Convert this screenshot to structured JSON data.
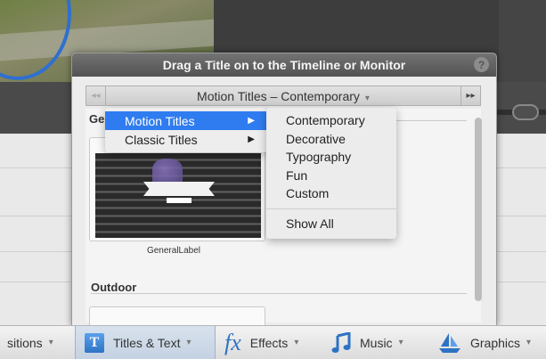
{
  "panel": {
    "title": "Drag a Title on to the Timeline or Monitor",
    "help_glyph": "?",
    "category": "Motion Titles – Contemporary",
    "nav_prev": "◂◂",
    "nav_next": "▸▸"
  },
  "content": {
    "section_general": "Ge",
    "thumb_label": "GeneralLabel",
    "section_outdoor": "Outdoor"
  },
  "menu": {
    "items": [
      {
        "label": "Motion Titles",
        "selected": true
      },
      {
        "label": "Classic Titles",
        "selected": false
      }
    ],
    "submenu": [
      "Contemporary",
      "Decorative",
      "Typography",
      "Fun",
      "Custom"
    ],
    "submenu_show_all": "Show All"
  },
  "toolbar": {
    "transitions": "sitions",
    "titles_icon": "T",
    "titles": "Titles & Text",
    "effects_icon": "fx",
    "effects": "Effects",
    "music": "Music",
    "graphics": "Graphics"
  },
  "colors": {
    "accent": "#2f7cf0",
    "panel_header": "#5f5f5f"
  }
}
